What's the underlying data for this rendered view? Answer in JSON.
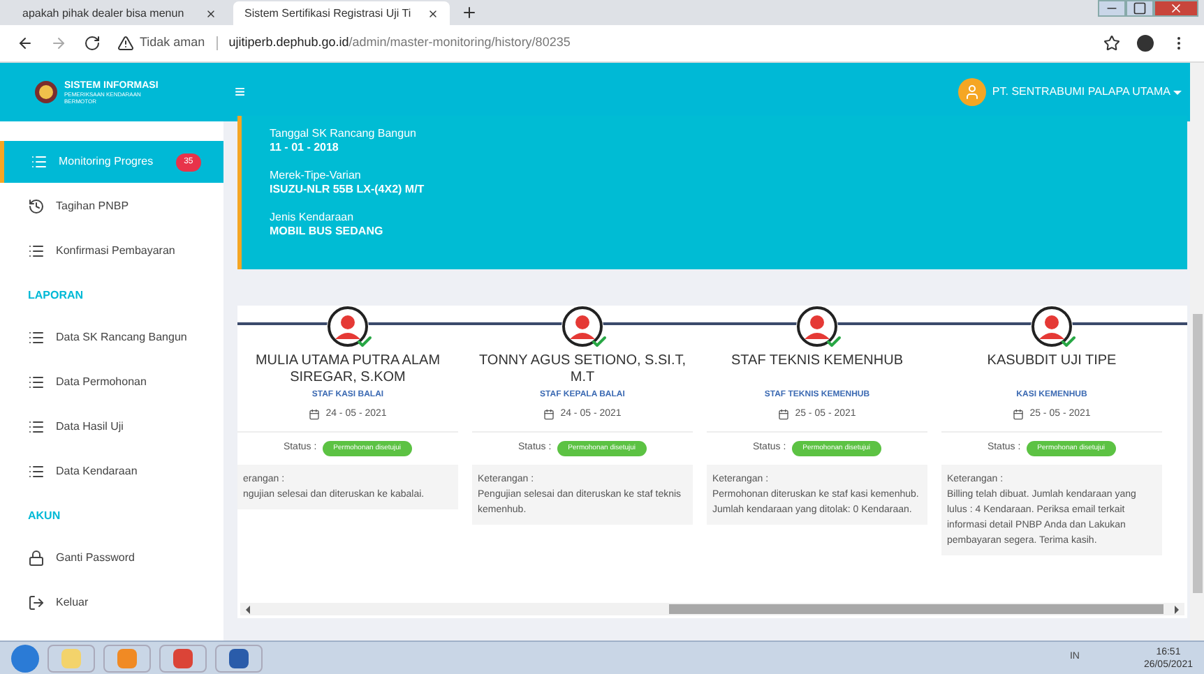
{
  "browser": {
    "tabs": [
      {
        "title": "apakah pihak dealer bisa menun",
        "selected": false
      },
      {
        "title": "Sistem Sertifikasi Registrasi Uji Ti",
        "selected": true
      }
    ],
    "security": "Tidak aman",
    "url_host": "ujitiperb.dephub.go.id",
    "url_path": "/admin/master-monitoring/history/80235"
  },
  "header": {
    "logo_title": "SISTEM INFORMASI",
    "logo_subtitle": "PEMERIKSAAN KENDARAAN BERMOTOR",
    "menu_glyph": "≡",
    "user": "PT. SENTRABUMI PALAPA UTAMA"
  },
  "sidebar": {
    "items": [
      {
        "kind": "list",
        "label": "Monitoring Progres",
        "badge": "35",
        "selected": true
      },
      {
        "kind": "history",
        "label": "Tagihan PNBP",
        "selected": false
      },
      {
        "kind": "list",
        "label": "Konfirmasi Pembayaran",
        "selected": false
      },
      {
        "kind": "heading",
        "label": "LAPORAN"
      },
      {
        "kind": "list",
        "label": "Data SK Rancang Bangun",
        "selected": false
      },
      {
        "kind": "list",
        "label": "Data Permohonan",
        "selected": false
      },
      {
        "kind": "list",
        "label": "Data Hasil Uji",
        "selected": false
      },
      {
        "kind": "list",
        "label": "Data Kendaraan",
        "selected": false
      },
      {
        "kind": "heading",
        "label": "AKUN"
      },
      {
        "kind": "lock",
        "label": "Ganti Password",
        "selected": false
      },
      {
        "kind": "logout",
        "label": "Keluar",
        "selected": false
      }
    ]
  },
  "info": [
    {
      "label": "Tanggal SK Rancang Bangun",
      "value": "11 - 01 - 2018"
    },
    {
      "label": "Merek-Tipe-Varian",
      "value": "ISUZU-NLR 55B LX-(4X2) M/T"
    },
    {
      "label": "Jenis Kendaraan",
      "value": "MOBIL BUS SEDANG"
    }
  ],
  "timeline": [
    {
      "name": "MULIA UTAMA PUTRA ALAM SIREGAR, S.KOM",
      "role": "STAF KASI BALAI",
      "date": "24 - 05 - 2021",
      "status_label": "Status :",
      "status": "Permohonan disetujui",
      "note_label": "erangan :",
      "note": "ngujian selesai dan diteruskan ke kabalai.",
      "done": true
    },
    {
      "name": "TONNY AGUS SETIONO, S.SI.T, M.T",
      "role": "STAF KEPALA BALAI",
      "date": "24 - 05 - 2021",
      "status_label": "Status :",
      "status": "Permohonan disetujui",
      "note_label": "Keterangan :",
      "note": "Pengujian selesai dan diteruskan ke staf teknis kemenhub.",
      "done": true
    },
    {
      "name": "STAF TEKNIS KEMENHUB",
      "role": "STAF TEKNIS KEMENHUB",
      "date": "25 - 05 - 2021",
      "status_label": "Status :",
      "status": "Permohonan disetujui",
      "note_label": "Keterangan :",
      "note": "Permohonan diteruskan ke staf kasi kemenhub. Jumlah kendaraan yang ditolak: 0 Kendaraan.",
      "done": true
    },
    {
      "name": "KASUBDIT UJI TIPE",
      "role": "KASI KEMENHUB",
      "date": "25 - 05 - 2021",
      "status_label": "Status :",
      "status": "Permohonan disetujui",
      "note_label": "Keterangan :",
      "note": "Billing telah dibuat. Jumlah kendaraan yang lulus : 4 Kendaraan. Periksa email terkait informasi detail PNBP Anda dan Lakukan pembayaran segera. Terima kasih.",
      "done": true
    }
  ],
  "taskbar": {
    "lang": "IN",
    "time": "16:51",
    "date": "26/05/2021"
  }
}
